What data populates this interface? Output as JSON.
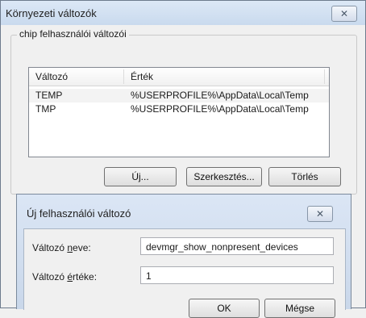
{
  "window": {
    "title": "Környezeti változók",
    "close_label": "✕"
  },
  "user_vars": {
    "group_label": "chip felhasználói változói",
    "columns": [
      "Változó",
      "Érték"
    ],
    "rows": [
      {
        "name": "TEMP",
        "value": "%USERPROFILE%\\AppData\\Local\\Temp"
      },
      {
        "name": "TMP",
        "value": "%USERPROFILE%\\AppData\\Local\\Temp"
      }
    ],
    "buttons": {
      "new": "Új...",
      "edit": "Szerkesztés...",
      "delete": "Törlés"
    }
  },
  "new_var_dialog": {
    "title": "Új felhasználói változó",
    "close_label": "✕",
    "name_label_pre": "Változó ",
    "name_label_u": "n",
    "name_label_post": "eve:",
    "name_value": "devmgr_show_nonpresent_devices",
    "value_label_pre": "Változó ",
    "value_label_u": "é",
    "value_label_post": "rtéke:",
    "value_value": "1",
    "ok_label": "OK",
    "cancel_label": "Mégse"
  }
}
